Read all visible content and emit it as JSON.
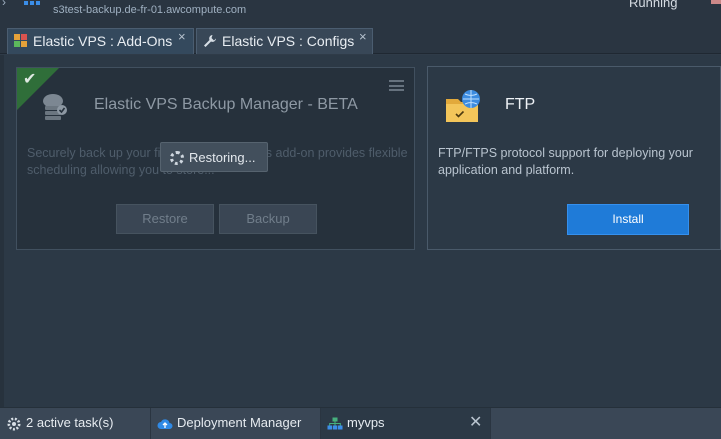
{
  "header": {
    "environment_url": "s3test-backup.de-fr-01.awcompute.com",
    "status": "Running"
  },
  "tabs": [
    {
      "label": "Elastic VPS : Add-Ons",
      "icon": "addons-icon",
      "active": true
    },
    {
      "label": "Elastic VPS : Configs",
      "icon": "wrench-icon",
      "active": false
    }
  ],
  "addons": {
    "backup": {
      "title": "Elastic VPS Backup Manager - BETA",
      "description": "Securely back up your files and folders. This add-on provides flexible scheduling allowing you to store...",
      "installed": true,
      "restore_label": "Restore",
      "backup_label": "Backup",
      "overlay_text": "Restoring..."
    },
    "ftp": {
      "title": "FTP",
      "description": "FTP/FTPS protocol support for deploying your application and platform.",
      "install_label": "Install"
    }
  },
  "taskbar": {
    "tasks_label": "2 active task(s)",
    "deployment_label": "Deployment Manager",
    "env_label": "myvps"
  },
  "colors": {
    "accent": "#1f7bd8",
    "installed_badge": "#2f6e39",
    "background": "#2f3b48"
  }
}
